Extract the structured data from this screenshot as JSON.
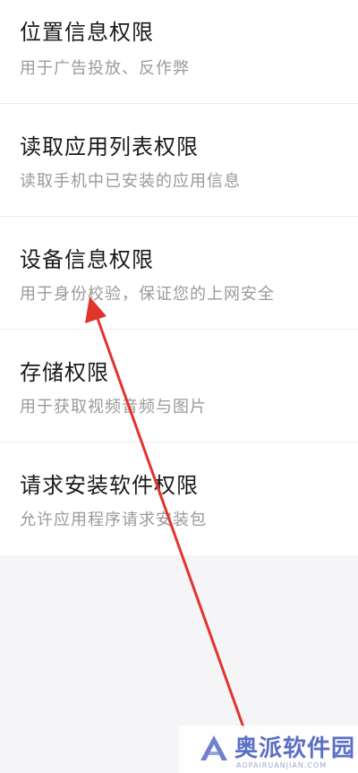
{
  "permissions": [
    {
      "title": "位置信息权限",
      "desc": "用于广告投放、反作弊"
    },
    {
      "title": "读取应用列表权限",
      "desc": "读取手机中已安装的应用信息"
    },
    {
      "title": "设备信息权限",
      "desc": "用于身份校验，保证您的上网安全"
    },
    {
      "title": "存储权限",
      "desc": "用于获取视频音频与图片"
    },
    {
      "title": "请求安装软件权限",
      "desc": "允许应用程序请求安装包"
    }
  ],
  "annotation": {
    "color": "#e0342c"
  },
  "watermark": {
    "name": "奥派软件园",
    "sub": "AOPAIRUANJIAN.COM",
    "color": "#5b6fc4"
  }
}
